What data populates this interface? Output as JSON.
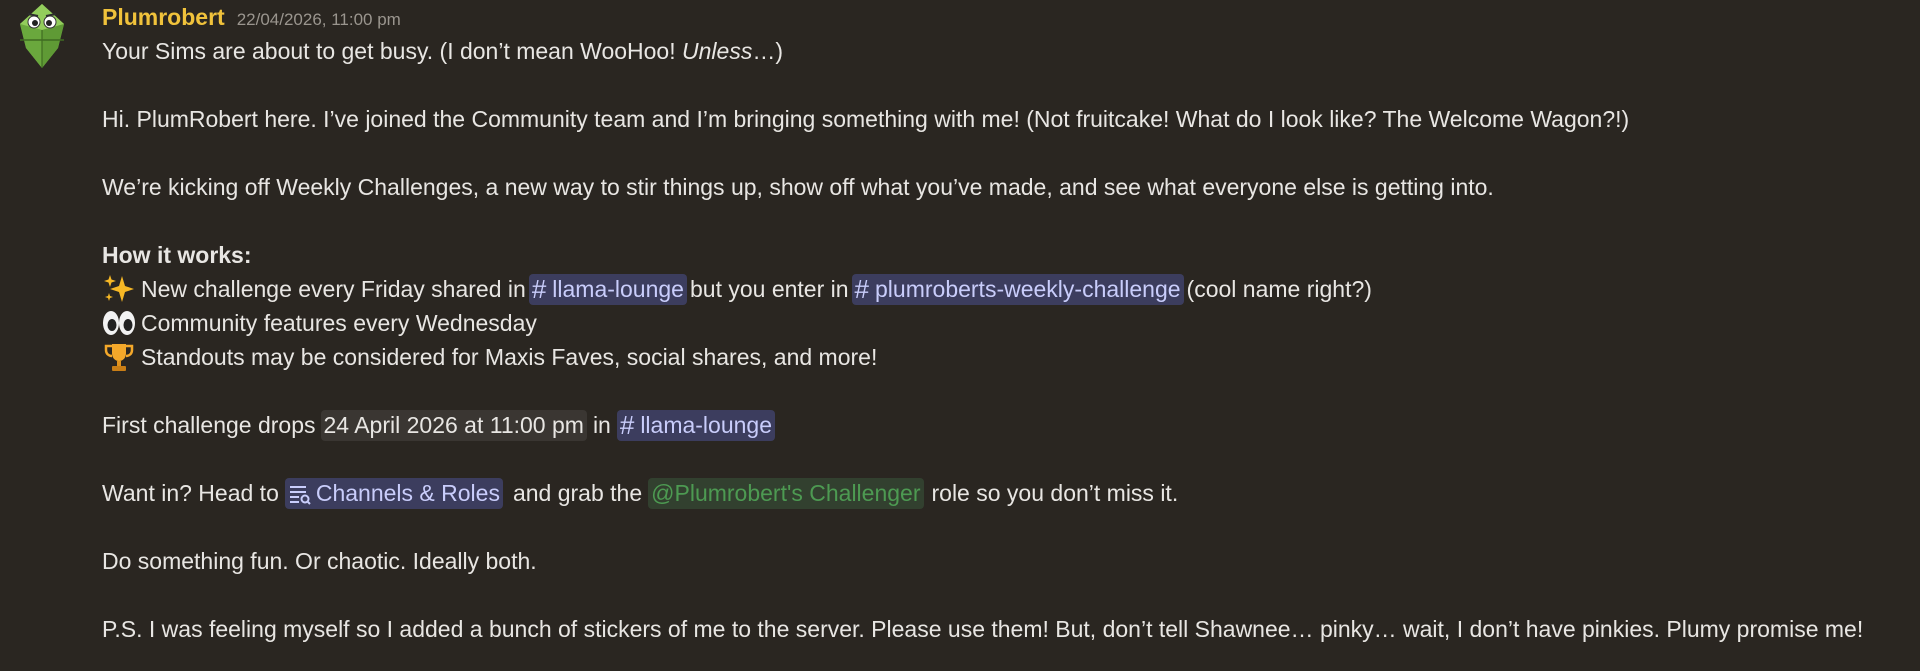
{
  "message": {
    "author": "Plumrobert",
    "timestamp": "22/04/2026, 11:00 pm",
    "line1": {
      "text": "Your Sims are about to get busy. (I don’t mean WooHoo! ",
      "italic": "Unless",
      "end": "…)"
    },
    "line2": "Hi. PlumRobert here. I’ve joined the Community team and I’m bringing something with me! (Not fruitcake! What do I look like? The Welcome Wagon?!)",
    "line3": "We’re kicking off Weekly Challenges, a new way to stir things up, show off what you’ve made, and see what everyone else is getting into.",
    "how_it_works": "How it works:",
    "bullet1": {
      "emoji": "sparkles",
      "text_a": "New challenge every Friday shared in",
      "channel_a": "llama-lounge",
      "text_b": "but you enter in",
      "channel_b": "plumroberts-weekly-challenge",
      "text_c": "(cool name right?)"
    },
    "bullet2": {
      "emoji": "eyes",
      "text": "Community features every Wednesday"
    },
    "bullet3": {
      "emoji": "trophy",
      "text": "Standouts may be considered for Maxis Faves, social shares, and more!"
    },
    "drops": {
      "text_a": "First challenge drops",
      "date": "24 April 2026 at 11:00 pm",
      "text_b": "in",
      "channel": "llama-lounge"
    },
    "want_in": {
      "text_a": "Want in? Head to",
      "channels_link": "Channels & Roles",
      "text_b": "and grab the",
      "role": "@Plumrobert's Challenger",
      "text_c": "role so you don’t miss it."
    },
    "fun": "Do something fun. Or chaotic. Ideally both.",
    "ps": "P.S. I was feeling myself so I added a bunch of stickers of me to the server. Please use them! But, don’t tell Shawnee… pinky… wait, I don’t have pinkies. Plumy promise me!"
  },
  "colors": {
    "background": "#2a2621",
    "username": "#f0c23b",
    "channel_mention_bg": "#3c3d5e",
    "channel_mention_text": "#c9cdfb",
    "role_mention_text": "#4d9a52"
  },
  "icons": {
    "avatar": "plumbob-avatar",
    "channel": "hash-icon",
    "channels_roles": "channels-roles-icon"
  }
}
